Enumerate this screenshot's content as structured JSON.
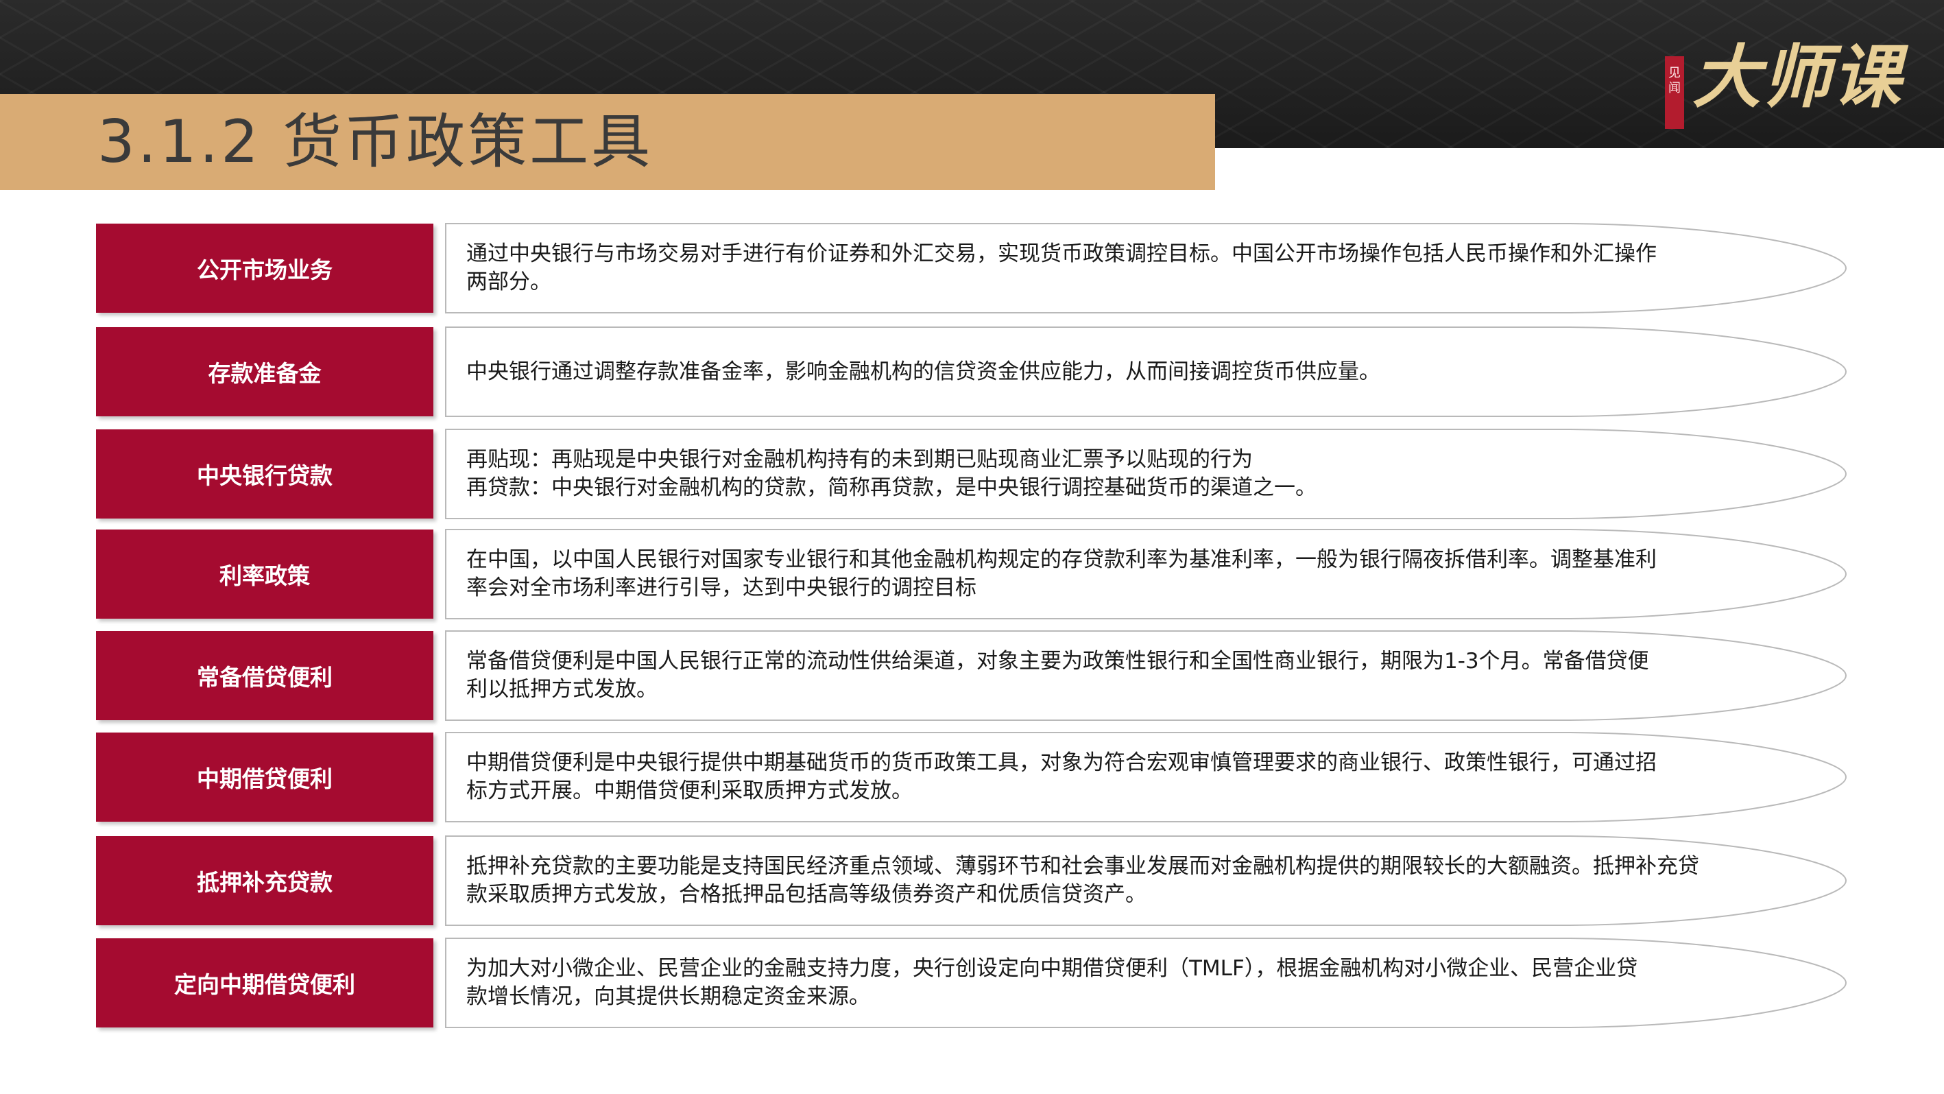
{
  "header": {
    "title": "3.1.2 货币政策工具",
    "logo_seal": "见闻",
    "logo_text": "大师课"
  },
  "rows": [
    {
      "label": "公开市场业务",
      "text": "通过中央银行与市场交易对手进行有价证券和外汇交易，实现货币政策调控目标。中国公开市场操作包括人民币操作和外汇操作\n两部分。"
    },
    {
      "label": "存款准备金",
      "text": "中央银行通过调整存款准备金率，影响金融机构的信贷资金供应能力，从而间接调控货币供应量。"
    },
    {
      "label": "中央银行贷款",
      "text": "再贴现：再贴现是中央银行对金融机构持有的未到期已贴现商业汇票予以贴现的行为\n再贷款：中央银行对金融机构的贷款，简称再贷款，是中央银行调控基础货币的渠道之一。"
    },
    {
      "label": "利率政策",
      "text": "在中国，以中国人民银行对国家专业银行和其他金融机构规定的存贷款利率为基准利率，一般为银行隔夜拆借利率。调整基准利\n率会对全市场利率进行引导，达到中央银行的调控目标"
    },
    {
      "label": "常备借贷便利",
      "text": "常备借贷便利是中国人民银行正常的流动性供给渠道，对象主要为政策性银行和全国性商业银行，期限为1-3个月。常备借贷便\n利以抵押方式发放。"
    },
    {
      "label": "中期借贷便利",
      "text": "中期借贷便利是中央银行提供中期基础货币的货币政策工具，对象为符合宏观审慎管理要求的商业银行、政策性银行，可通过招\n标方式开展。中期借贷便利采取质押方式发放。"
    },
    {
      "label": "抵押补充贷款",
      "text": "抵押补充贷款的主要功能是支持国民经济重点领域、薄弱环节和社会事业发展而对金融机构提供的期限较长的大额融资。抵押补充贷\n款采取质押方式发放，合格抵押品包括高等级债券资产和优质信贷资产。"
    },
    {
      "label": "定向中期借贷便利",
      "text": "为加大对小微企业、民营企业的金融支持力度，央行创设定向中期借贷便利（TMLF），根据金融机构对小微企业、民营企业贷\n款增长情况，向其提供长期稳定资金来源。"
    }
  ]
}
